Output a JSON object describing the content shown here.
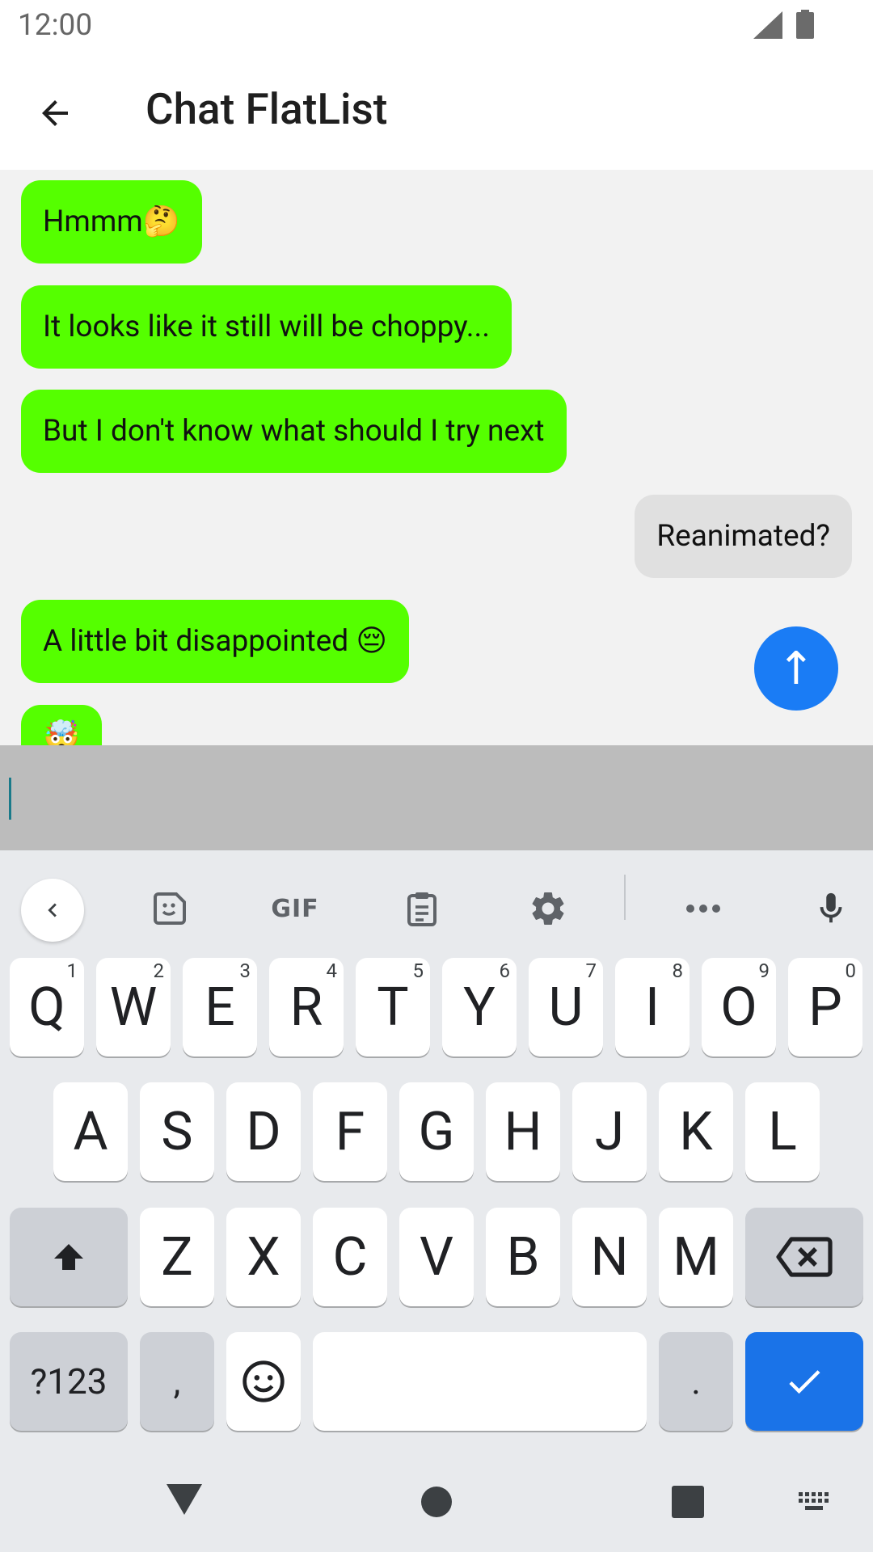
{
  "status_bar": {
    "time": "12:00"
  },
  "app_bar": {
    "title": "Chat FlatList"
  },
  "messages": [
    {
      "text": "Hmmm",
      "emoji": "🤔",
      "side": "in"
    },
    {
      "text": "It looks like it still will be choppy...",
      "emoji": "",
      "side": "in"
    },
    {
      "text": "But I don't know what should I try next",
      "emoji": "",
      "side": "in"
    },
    {
      "text": "Reanimated?",
      "emoji": "",
      "side": "out"
    },
    {
      "text": "A little bit disappointed ",
      "emoji": "😔",
      "side": "in"
    },
    {
      "text": "",
      "emoji": "🤯",
      "side": "in"
    }
  ],
  "fab": {
    "label": "↑"
  },
  "input": {
    "value": ""
  },
  "keyboard": {
    "toolbar": {
      "gif_label": "GIF"
    },
    "row1": [
      "Q",
      "W",
      "E",
      "R",
      "T",
      "Y",
      "U",
      "I",
      "O",
      "P"
    ],
    "row1_hints": [
      "1",
      "2",
      "3",
      "4",
      "5",
      "6",
      "7",
      "8",
      "9",
      "0"
    ],
    "row2": [
      "A",
      "S",
      "D",
      "F",
      "G",
      "H",
      "J",
      "K",
      "L"
    ],
    "row3": [
      "Z",
      "X",
      "C",
      "V",
      "B",
      "N",
      "M"
    ],
    "symbols_label": "?123",
    "comma_label": ",",
    "period_label": "."
  },
  "colors": {
    "incoming_bubble": "#55ff00",
    "outgoing_bubble": "#e0e0e0",
    "fab": "#1a7cf5",
    "enter_key": "#1a73e8"
  }
}
